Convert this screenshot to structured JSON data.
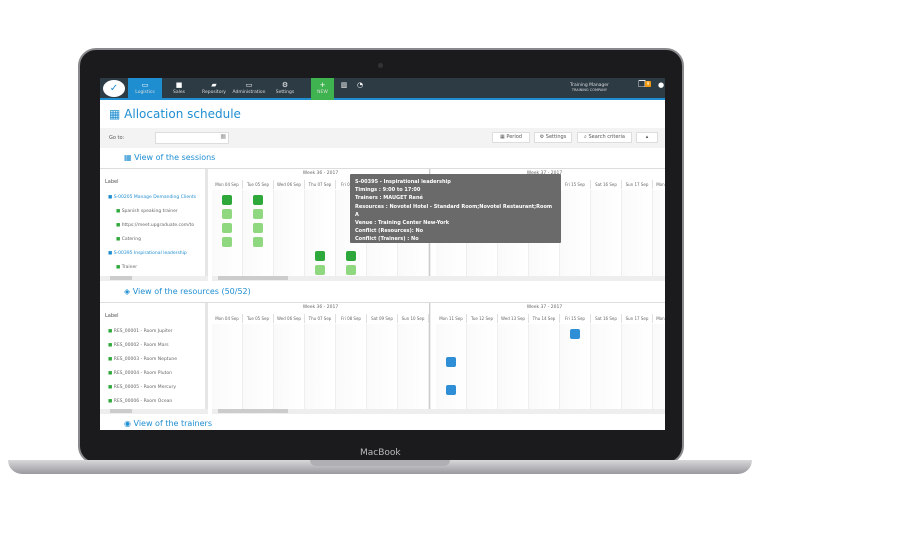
{
  "device": {
    "brand": "MacBook"
  },
  "nav": {
    "items": [
      {
        "label": "Logistics",
        "icon": "monitor-icon",
        "active": true
      },
      {
        "label": "Sales",
        "icon": "briefcase-icon"
      },
      {
        "label": "Repository",
        "icon": "books-icon"
      },
      {
        "label": "Administration",
        "icon": "desktop-icon"
      },
      {
        "label": "Settings",
        "icon": "gears-icon"
      }
    ],
    "new_label": "NEW",
    "user_name": "Training Manager",
    "company": "TRAINING COMPANY",
    "notification_count": "9"
  },
  "page": {
    "title": "Allocation schedule",
    "goto_label": "Go to:",
    "goto_value": "",
    "buttons": {
      "period": "Period",
      "settings": "Settings",
      "search": "Search criteria"
    }
  },
  "sessions": {
    "heading": "View of the sessions",
    "label_header": "Label",
    "week1": "Week 36 - 2017",
    "week2": "Week 37 - 2017",
    "days": [
      "Mon 04 Sep",
      "Tue 05 Sep",
      "Wed 06 Sep",
      "Thu 07 Sep",
      "Fri 08 Sep",
      "Sat 09 Sep",
      "Sun 10 Sep",
      "Mon 11 Sep",
      "Tue 12 Sep",
      "Wed 13 Sep",
      "Thu 14 Sep",
      "Fri 15 Sep",
      "Sat 16 Sep",
      "Sun 17 Sep",
      "Mon 18 Sep"
    ],
    "rows": [
      "S-00205 Manage Demanding Clients",
      "Spanish speaking trainer",
      "https://meet.upgraduate.com/to",
      "Catering",
      "S-00395 Inspirational leadership",
      "Trainer"
    ],
    "tooltip": [
      "S-00395 - Inspirational leadership",
      "Timings : 9:00 to 17:00",
      "Trainers : MAUGET René",
      "Resources : Novotel Hotel - Standard Room;Novotel Restaurant;Room A",
      "Venue : Training Center New-York",
      "Conflict (Resources): No",
      "Conflict (Trainers) : No"
    ]
  },
  "resources": {
    "heading": "View of the resources (50/52)",
    "label_header": "Label",
    "rows": [
      "RES_00001 - Room Jupiter",
      "RES_00002 - Room Mars",
      "RES_00003 - Room Neptune",
      "RES_00004 - Room Pluton",
      "RES_00005 - Room Mercury",
      "RES_00006 - Room Ocean"
    ]
  },
  "trainers": {
    "heading": "View of the trainers"
  },
  "colors": {
    "accent": "#1f8ed1",
    "topbar": "#2d3b45",
    "new": "#3fb34f",
    "session_dark": "#2ea83a",
    "session_light": "#8fd87f",
    "resource": "#2f8fd6"
  }
}
